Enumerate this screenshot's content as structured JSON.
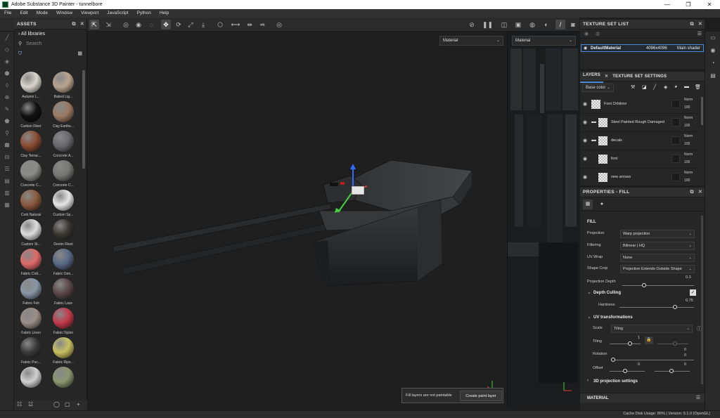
{
  "window": {
    "title": "Adobe Substance 3D Painter - tunnelbore",
    "controls": [
      "—",
      "❐",
      "✕"
    ]
  },
  "menu": [
    "File",
    "Edit",
    "Mode",
    "Window",
    "Viewport",
    "JavaScript",
    "Python",
    "Help"
  ],
  "assets": {
    "header": "ASSETS",
    "library": "All libraries",
    "search_placeholder": "Search",
    "items": [
      {
        "label": "Autumn L...",
        "color": "#d9d4cc"
      },
      {
        "label": "Baked Lig...",
        "color": "#b9a48e"
      },
      {
        "label": "Carbon Fiber",
        "color": "#111111"
      },
      {
        "label": "Clay Earthe...",
        "color": "#9a7a62"
      },
      {
        "label": "Clay Terrac...",
        "color": "#8a4b32"
      },
      {
        "label": "Concrete A...",
        "color": "#6a6a6e"
      },
      {
        "label": "Concrete C...",
        "color": "#8a8a88"
      },
      {
        "label": "Concrete C...",
        "color": "#777775"
      },
      {
        "label": "Cork Natural",
        "color": "#8a5a3e"
      },
      {
        "label": "Custom Sp...",
        "color": "#e6e6e6"
      },
      {
        "label": "Custom St...",
        "color": "#dddddd"
      },
      {
        "label": "Denim Rivet",
        "color": "#3b3732"
      },
      {
        "label": "Fabric Cott...",
        "color": "#e06a6a"
      },
      {
        "label": "Fabric Den...",
        "color": "#5a6a86"
      },
      {
        "label": "Fabric Felt",
        "color": "#8896a6"
      },
      {
        "label": "Fabric Lace",
        "color": "#5a4848"
      },
      {
        "label": "Fabric Linen",
        "color": "#9a8e86"
      },
      {
        "label": "Fabric Nylon",
        "color": "#c23a4a"
      },
      {
        "label": "Fabric Puc...",
        "color": "#3a3a3a"
      },
      {
        "label": "Fabric Rips...",
        "color": "#c8c060"
      },
      {
        "label": "",
        "color": "#cfcfcf"
      },
      {
        "label": "",
        "color": "#8a9670"
      }
    ]
  },
  "viewport": {
    "material_dropdown": "Material",
    "uv_dropdown": "Material",
    "toast_message": "Fill layers are not paintable",
    "toast_button": "Create paint layer"
  },
  "texture_set_list": {
    "header": "TEXTURE SET LIST",
    "item": {
      "name": "DefaultMaterial",
      "size": "4096x4096",
      "shader": "Main shader"
    }
  },
  "layers": {
    "tab_layers": "LAYERS",
    "tab_settings": "TEXTURE SET SETTINGS",
    "channel": "Base color",
    "rows": [
      {
        "name": "Font Orbitron",
        "blend": "Norm",
        "opacity": "100"
      },
      {
        "name": "Steel Painted Rough Damaged",
        "blend": "Norm",
        "opacity": "100"
      },
      {
        "name": "decals",
        "blend": "Norm",
        "opacity": "100"
      },
      {
        "name": "font",
        "blend": "Norm",
        "opacity": "100"
      },
      {
        "name": "new arrows",
        "blend": "Norm",
        "opacity": "100"
      }
    ]
  },
  "properties": {
    "header": "PROPERTIES - FILL",
    "section_fill": "FILL",
    "projection_label": "Projection",
    "projection_value": "Warp projection",
    "filtering_label": "Filtering",
    "filtering_value": "Bilinear | HQ",
    "uvwrap_label": "UV Wrap",
    "uvwrap_value": "None",
    "shapecrop_label": "Shape Crop",
    "shapecrop_value": "Projection Extends Outside Shape",
    "projdepth_label": "Projection Depth",
    "projdepth_value": "0.3",
    "depth_culling": "Depth Culling",
    "hardness_label": "Hardness",
    "hardness_value": "0.75",
    "uv_transformations": "UV transformations",
    "scale_label": "Scale",
    "scale_value": "Tiling",
    "tiling_label": "Tiling",
    "tiling_value": "1",
    "rotation_label": "Rotation",
    "rotation_value": "0",
    "offset_label": "Offset",
    "offset_x": "0",
    "offset_y": "0",
    "tiling_y_value": "0",
    "projection_settings": "3D projection settings",
    "material_section": "MATERIAL"
  },
  "status": {
    "text": "Cache Disk Usage:   86%  |  Version: 9.1.0 (OpenGL)"
  }
}
